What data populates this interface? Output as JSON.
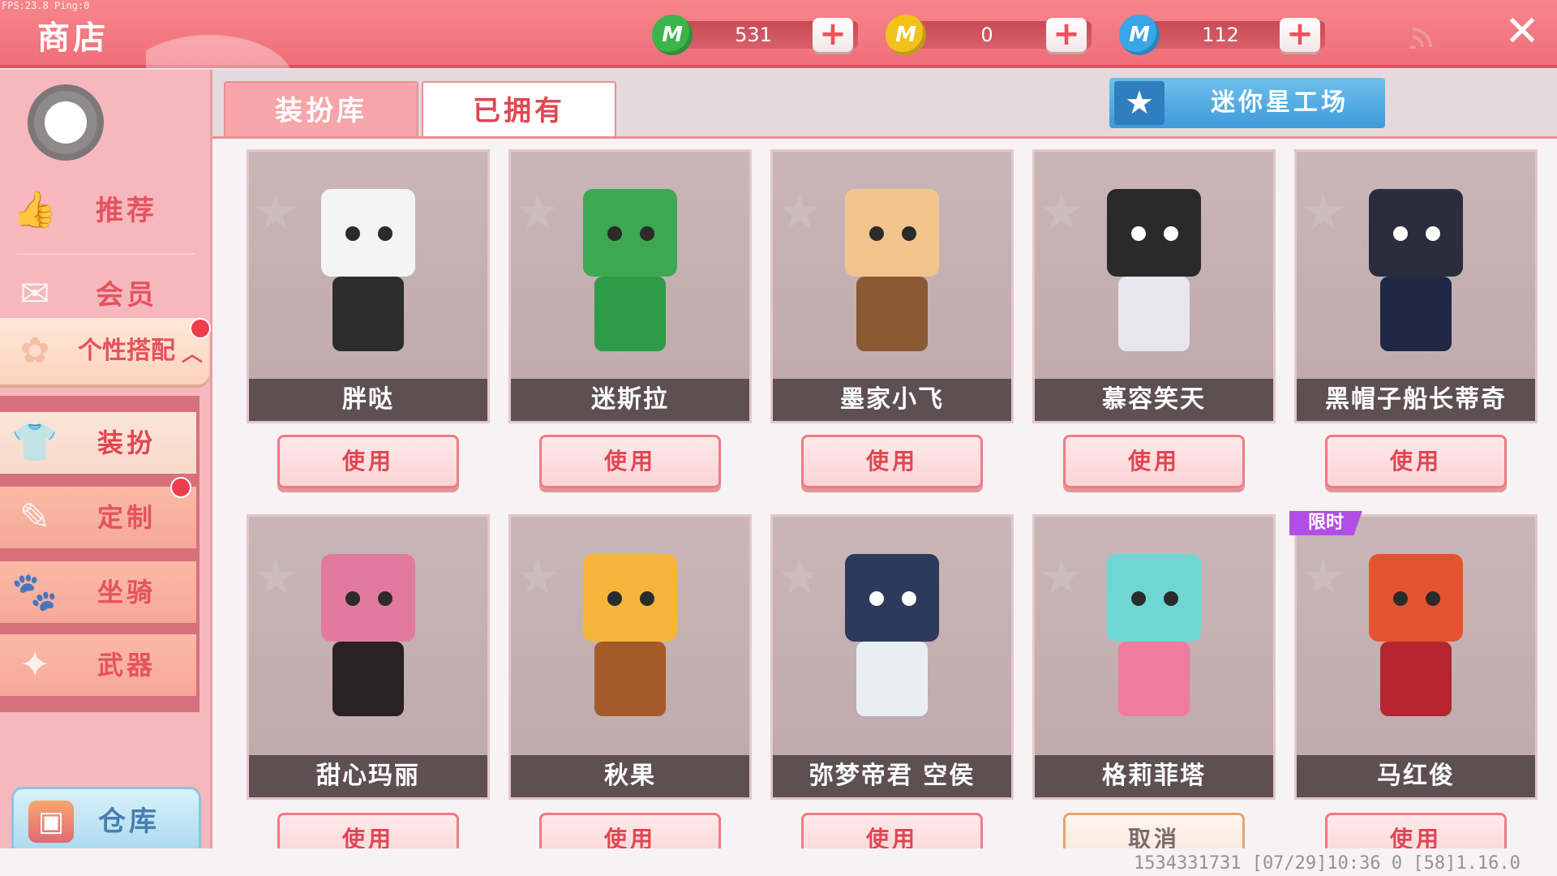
{
  "fps_text": "FPS:23.8  Ping:0",
  "title": "商店",
  "currencies": [
    {
      "icon": "green-m-coin-icon",
      "coin_letter": "M",
      "color": "#3bb54a",
      "amount": "531",
      "plus": "+"
    },
    {
      "icon": "gold-m-coin-icon",
      "coin_letter": "M",
      "color": "#f2c21b",
      "amount": "0",
      "plus": "+"
    },
    {
      "icon": "blue-m-star-icon",
      "coin_letter": "M",
      "color": "#3aa5e8",
      "amount": "112",
      "plus": "+"
    }
  ],
  "signal_icon": "signal-icon",
  "close_icon": "✕",
  "sidebar": {
    "items": [
      {
        "label": "推荐",
        "icon": "thumbs-up-icon",
        "glyph": "👍"
      },
      {
        "label": "会员",
        "icon": "vip-card-icon",
        "glyph": "✉"
      },
      {
        "label": "个性搭配",
        "icon": "palette-icon",
        "glyph": "✿",
        "arrow": "︿"
      }
    ],
    "sub_items": [
      {
        "label": "装扮",
        "icon": "outfit-icon",
        "glyph": "👕"
      },
      {
        "label": "定制",
        "icon": "custom-brush-icon",
        "glyph": "✎"
      },
      {
        "label": "坐骑",
        "icon": "mount-icon",
        "glyph": "🐾"
      },
      {
        "label": "武器",
        "icon": "weapon-gun-icon",
        "glyph": "✦"
      }
    ],
    "warehouse_label": "仓库",
    "warehouse_glyph": "▣"
  },
  "tabs": {
    "library": "装扮库",
    "owned": "已拥有"
  },
  "workshop_label": "迷你星工场",
  "workshop_glyph": "★",
  "cards": [
    {
      "name": "胖哒",
      "button": "使用",
      "head": "#f4f4f4",
      "body": "#2d2d2d"
    },
    {
      "name": "迷斯拉",
      "button": "使用",
      "head": "#3ca852",
      "body": "#2f9a47"
    },
    {
      "name": "墨家小飞",
      "button": "使用",
      "head": "#f2c58f",
      "body": "#8a5a34"
    },
    {
      "name": "慕容笑天",
      "button": "使用",
      "head": "#2a2a2a",
      "body": "#e6e6ec"
    },
    {
      "name": "黑帽子船长蒂奇",
      "button": "使用",
      "head": "#2a2d3c",
      "body": "#1f2846"
    },
    {
      "name": "甜心玛丽",
      "button": "使用",
      "head": "#e27aa0",
      "body": "#2a2125"
    },
    {
      "name": "秋果",
      "button": "使用",
      "head": "#f4b53a",
      "body": "#a55a2a"
    },
    {
      "name": "弥梦帝君 空侯",
      "button": "使用",
      "head": "#2e3a5c",
      "body": "#e9eef5"
    },
    {
      "name": "格莉菲塔",
      "button": "取消",
      "head": "#6fd7d3",
      "body": "#f07aa0"
    },
    {
      "name": "马红俊",
      "button": "使用",
      "head": "#e5542e",
      "body": "#b5252f"
    }
  ],
  "limited_tag": "限时",
  "footer": "1534331731  [07/29]10:36 0 [58]1.16.0"
}
